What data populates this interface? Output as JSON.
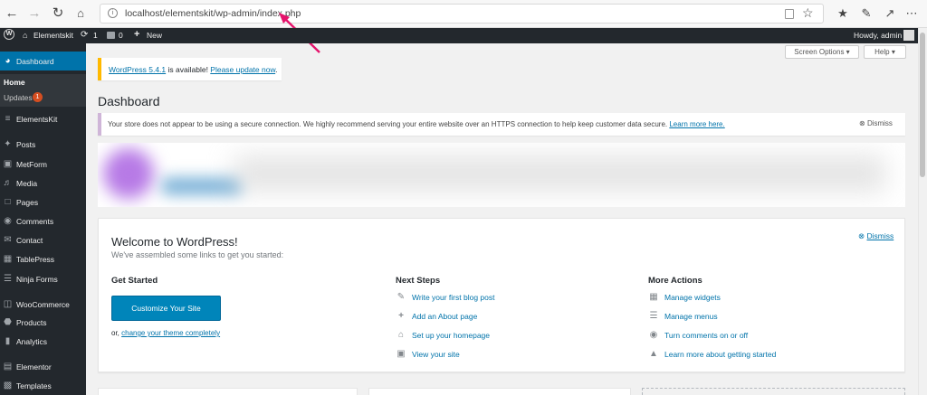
{
  "browser": {
    "url": "localhost/elementskit/wp-admin/index.php"
  },
  "adminbar": {
    "site_name": "Elementskit",
    "updates_count": "1",
    "comments_count": "0",
    "new_label": "New",
    "howdy": "Howdy, admin"
  },
  "sidebar": {
    "dashboard": "Dashboard",
    "home": "Home",
    "updates": "Updates",
    "updates_badge": "1",
    "items": [
      "ElementsKit",
      "Posts",
      "MetForm",
      "Media",
      "Pages",
      "Comments",
      "Contact",
      "TablePress",
      "Ninja Forms",
      "WooCommerce",
      "Products",
      "Analytics",
      "Elementor",
      "Templates"
    ]
  },
  "top_buttons": {
    "screen_options": "Screen Options",
    "help": "Help"
  },
  "update_notice": {
    "version_link": "WordPress 5.4.1",
    "middle": " is available! ",
    "update_link": "Please update now",
    "end": "."
  },
  "page_title": "Dashboard",
  "ssl_notice": {
    "text": "Your store does not appear to be using a secure connection. We highly recommend serving your entire website over an HTTPS connection to help keep customer data secure. ",
    "learn_more": "Learn more here.",
    "dismiss": "Dismiss"
  },
  "welcome": {
    "title": "Welcome to WordPress!",
    "subtitle": "We've assembled some links to get you started:",
    "dismiss": "Dismiss",
    "get_started": {
      "heading": "Get Started",
      "button": "Customize Your Site",
      "or_text": "or, ",
      "theme_link": "change your theme completely"
    },
    "next_steps": {
      "heading": "Next Steps",
      "items": [
        "Write your first blog post",
        "Add an About page",
        "Set up your homepage",
        "View your site"
      ]
    },
    "more_actions": {
      "heading": "More Actions",
      "items": [
        "Manage widgets",
        "Manage menus",
        "Turn comments on or off",
        "Learn more about getting started"
      ]
    }
  },
  "colors": {
    "accent": "#0073aa",
    "adminbar": "#23282d",
    "annotation_arrow": "#e5126b"
  }
}
